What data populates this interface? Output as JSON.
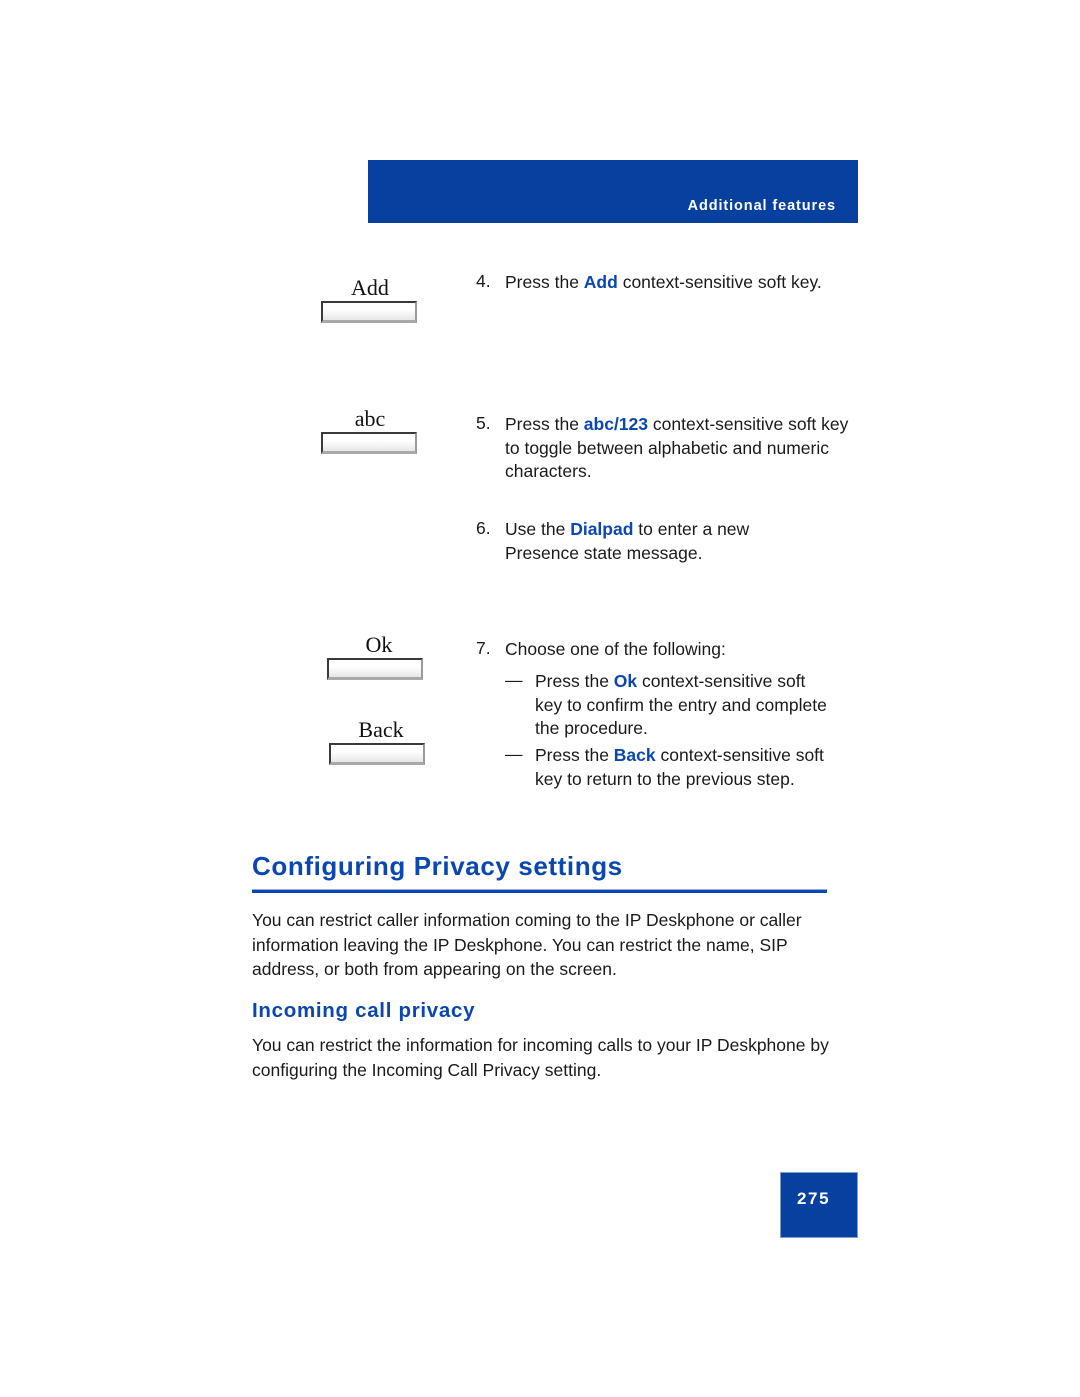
{
  "header": {
    "running_head": "Additional features",
    "band_color": "#08409f"
  },
  "theme": {
    "accent_blue": "#0b47b0",
    "band_blue": "#08409f",
    "body_text": "#1a1a1a"
  },
  "softkeys": [
    {
      "name": "add",
      "label": "Add"
    },
    {
      "name": "abc",
      "label": "abc"
    },
    {
      "name": "ok",
      "label": "Ok"
    },
    {
      "name": "back",
      "label": "Back"
    }
  ],
  "steps": [
    {
      "number": "4.",
      "text_parts": [
        {
          "t": "Press the ",
          "style": "plain"
        },
        {
          "t": "Add",
          "style": "keyword"
        },
        {
          "t": " context-sensitive soft key.",
          "style": "plain"
        }
      ]
    },
    {
      "number": "5.",
      "text_parts": [
        {
          "t": "Press the ",
          "style": "plain"
        },
        {
          "t": "abc",
          "style": "keyword"
        },
        {
          "t": "/",
          "style": "keyword"
        },
        {
          "t": "123",
          "style": "keyword"
        },
        {
          "t": " context-sensitive soft key to toggle between alphabetic and numeric characters.",
          "style": "plain"
        }
      ]
    },
    {
      "number": "6.",
      "text_parts": [
        {
          "t": "Use the ",
          "style": "plain"
        },
        {
          "t": "Dialpad",
          "style": "keyword"
        },
        {
          "t": " to enter a new Presence state message.",
          "style": "plain"
        }
      ]
    },
    {
      "number": "7.",
      "text_parts": [
        {
          "t": "Choose one of the following:",
          "style": "plain"
        }
      ]
    }
  ],
  "step7_options": [
    {
      "marker": "—",
      "text_parts": [
        {
          "t": "Press the ",
          "style": "plain"
        },
        {
          "t": "Ok",
          "style": "keyword"
        },
        {
          "t": " context-sensitive soft key to confirm the entry and complete the procedure.",
          "style": "plain"
        }
      ]
    },
    {
      "marker": "—",
      "text_parts": [
        {
          "t": "Press the ",
          "style": "plain"
        },
        {
          "t": "Back",
          "style": "keyword"
        },
        {
          "t": " context-sensitive soft key to return to the previous step.",
          "style": "plain"
        }
      ]
    }
  ],
  "section": {
    "heading": "Configuring Privacy settings",
    "intro_paragraph": "You can restrict caller information coming to the IP Deskphone or caller information leaving the IP Deskphone. You can restrict the name, SIP address, or both from appearing on the screen.",
    "subheading": "Incoming call privacy",
    "sub_paragraph": "You can restrict the information for incoming calls to your IP Deskphone by configuring the Incoming Call Privacy setting."
  },
  "footer": {
    "page_number": "275"
  }
}
